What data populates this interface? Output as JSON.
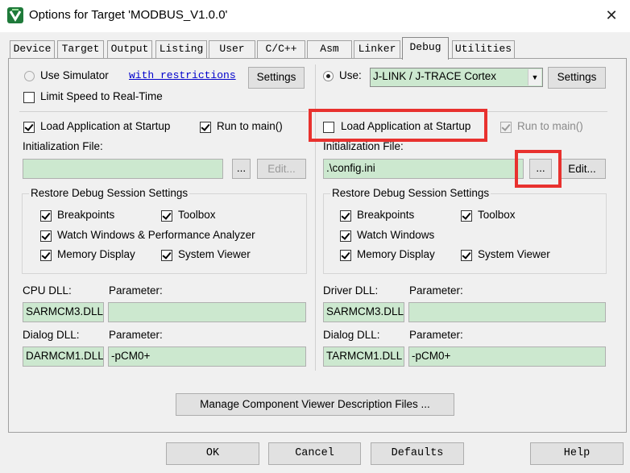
{
  "window": {
    "title": "Options for Target 'MODBUS_V1.0.0'",
    "close": "✕"
  },
  "tabs": [
    "Device",
    "Target",
    "Output",
    "Listing",
    "User",
    "C/C++",
    "Asm",
    "Linker",
    "Debug",
    "Utilities"
  ],
  "active_tab": "Debug",
  "left": {
    "use_simulator_label": "Use Simulator",
    "with_restrictions_link": "with restrictions",
    "settings_label": "Settings",
    "limit_speed_label": "Limit Speed to Real-Time",
    "load_app_label": "Load Application at Startup",
    "run_to_main_label": "Run to main()",
    "init_file_label": "Initialization File:",
    "init_file_value": "",
    "browse_label": "...",
    "edit_label": "Edit...",
    "restore_group_title": "Restore Debug Session Settings",
    "breakpoints_label": "Breakpoints",
    "toolbox_label": "Toolbox",
    "watch_windows_label": "Watch Windows & Performance Analyzer",
    "memory_display_label": "Memory Display",
    "system_viewer_label": "System Viewer",
    "cpu_dll_label": "CPU DLL:",
    "parameter_label": "Parameter:",
    "cpu_dll_value": "SARMCM3.DLL",
    "cpu_param_value": "",
    "dialog_dll_label": "Dialog DLL:",
    "dialog_dll_value": "DARMCM1.DLL",
    "dialog_param_value": "-pCM0+"
  },
  "right": {
    "use_label": "Use:",
    "debugger_value": "J-LINK / J-TRACE Cortex",
    "settings_label": "Settings",
    "load_app_label": "Load Application at Startup",
    "run_to_main_label": "Run to main()",
    "init_file_label": "Initialization File:",
    "init_file_value": ".\\config.ini",
    "browse_label": "...",
    "edit_label": "Edit...",
    "restore_group_title": "Restore Debug Session Settings",
    "breakpoints_label": "Breakpoints",
    "toolbox_label": "Toolbox",
    "watch_windows_label": "Watch Windows",
    "memory_display_label": "Memory Display",
    "system_viewer_label": "System Viewer",
    "driver_dll_label": "Driver DLL:",
    "parameter_label": "Parameter:",
    "driver_dll_value": "SARMCM3.DLL",
    "driver_param_value": "",
    "dialog_dll_label": "Dialog DLL:",
    "dialog_dll_value": "TARMCM1.DLL",
    "dialog_param_value": "-pCM0+"
  },
  "manage_button_label": "Manage Component Viewer Description Files ...",
  "footer": {
    "ok": "OK",
    "cancel": "Cancel",
    "defaults": "Defaults",
    "help": "Help"
  },
  "colors": {
    "field_bg": "#cce8cf",
    "highlight_red": "#e8312e",
    "dialog_bg": "#f0f0f0"
  }
}
